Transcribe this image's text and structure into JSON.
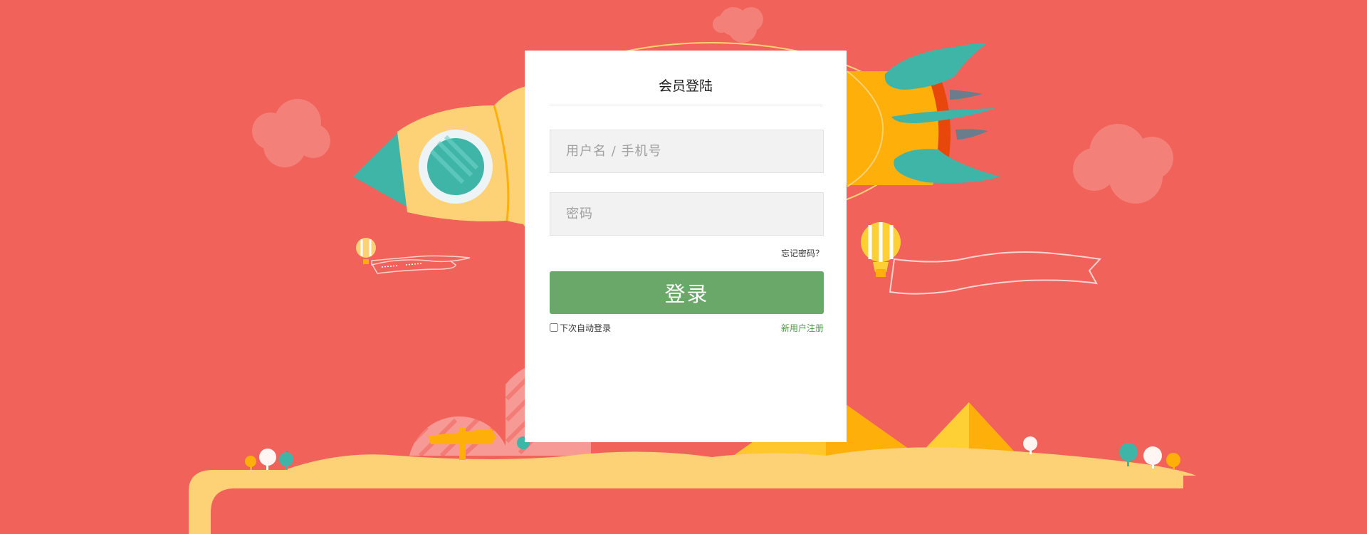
{
  "login": {
    "title": "会员登陆",
    "username_placeholder": "用户名 / 手机号",
    "password_placeholder": "密码",
    "forgot_password": "忘记密码？",
    "login_button": "登录",
    "remember_me": "下次自动登录",
    "register": "新用户注册"
  },
  "colors": {
    "background": "#f0625a",
    "login_button": "#6aa86a",
    "register_link": "#4a9a4a",
    "ground": "#fdd176",
    "rocket_body": "#fdd176",
    "rocket_engine": "#ffaf0a",
    "rocket_flame": "#e8470c",
    "rocket_fins": "#3fb5a8",
    "clouds": "#f4807a"
  },
  "illustration": {
    "icons": [
      "rocket-icon",
      "cloud-icon",
      "hot-air-balloon-icon",
      "ribbon-banner-icon",
      "pyramid-icon",
      "signpost-icon",
      "tree-icon"
    ]
  }
}
